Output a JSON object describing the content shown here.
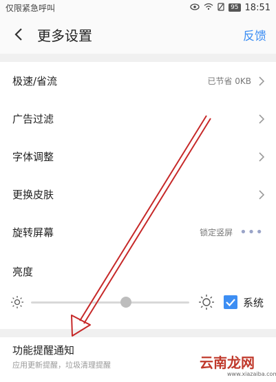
{
  "status_bar": {
    "left_text": "仅限紧急呼叫",
    "battery": "95",
    "time": "18:51"
  },
  "header": {
    "title": "更多设置",
    "feedback": "反馈"
  },
  "settings": {
    "rows": [
      {
        "label": "极速/省流",
        "value": "已节省 0KB"
      },
      {
        "label": "广告过滤",
        "value": ""
      },
      {
        "label": "字体调整",
        "value": ""
      },
      {
        "label": "更换皮肤",
        "value": ""
      },
      {
        "label": "旋转屏幕",
        "value": "锁定竖屏"
      }
    ]
  },
  "brightness": {
    "label": "亮度",
    "level_fraction": 0.6,
    "system_label": "系统",
    "system_checked": true
  },
  "notification": {
    "title": "功能提醒通知",
    "subtitle": "应用更新提醒，垃圾清理提醒"
  },
  "watermark": {
    "text": "云南龙网",
    "url": "www.xiazaiba.com"
  },
  "colors": {
    "accent": "#3d8ef3",
    "annotation": "#c62828"
  }
}
